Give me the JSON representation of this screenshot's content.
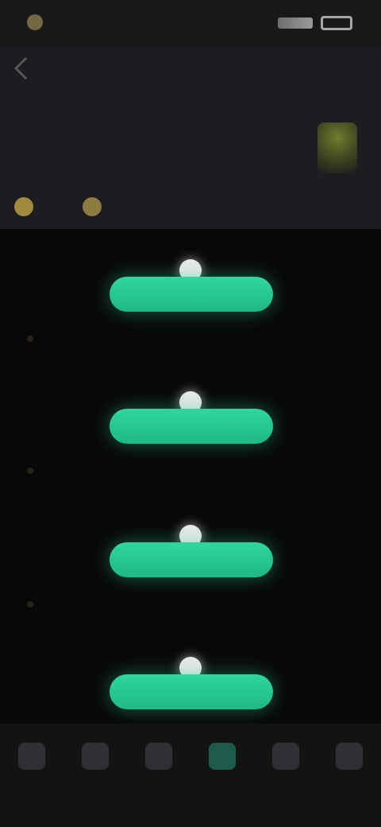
{
  "status_bar": {
    "left_label": "",
    "right_label": ""
  },
  "header": {
    "title": "",
    "user_name": "",
    "user_level": "",
    "coins": "",
    "gems": "",
    "trophy_label": ""
  },
  "timeline": {
    "nodes": [
      {
        "left_text": "",
        "right_text": "",
        "button_label": ""
      },
      {
        "left_text": "",
        "right_text": "",
        "button_label": ""
      },
      {
        "left_text": "",
        "right_text": "",
        "button_label": ""
      },
      {
        "left_text": "",
        "right_text": "",
        "button_label": ""
      }
    ]
  },
  "bottom_nav": {
    "items": [
      {
        "label": ""
      },
      {
        "label": ""
      },
      {
        "label": ""
      },
      {
        "label": ""
      },
      {
        "label": ""
      },
      {
        "label": ""
      }
    ],
    "active_index": 3
  },
  "colors": {
    "accent": "#2ed79e",
    "background": "#070707",
    "header": "#1c1d20"
  }
}
